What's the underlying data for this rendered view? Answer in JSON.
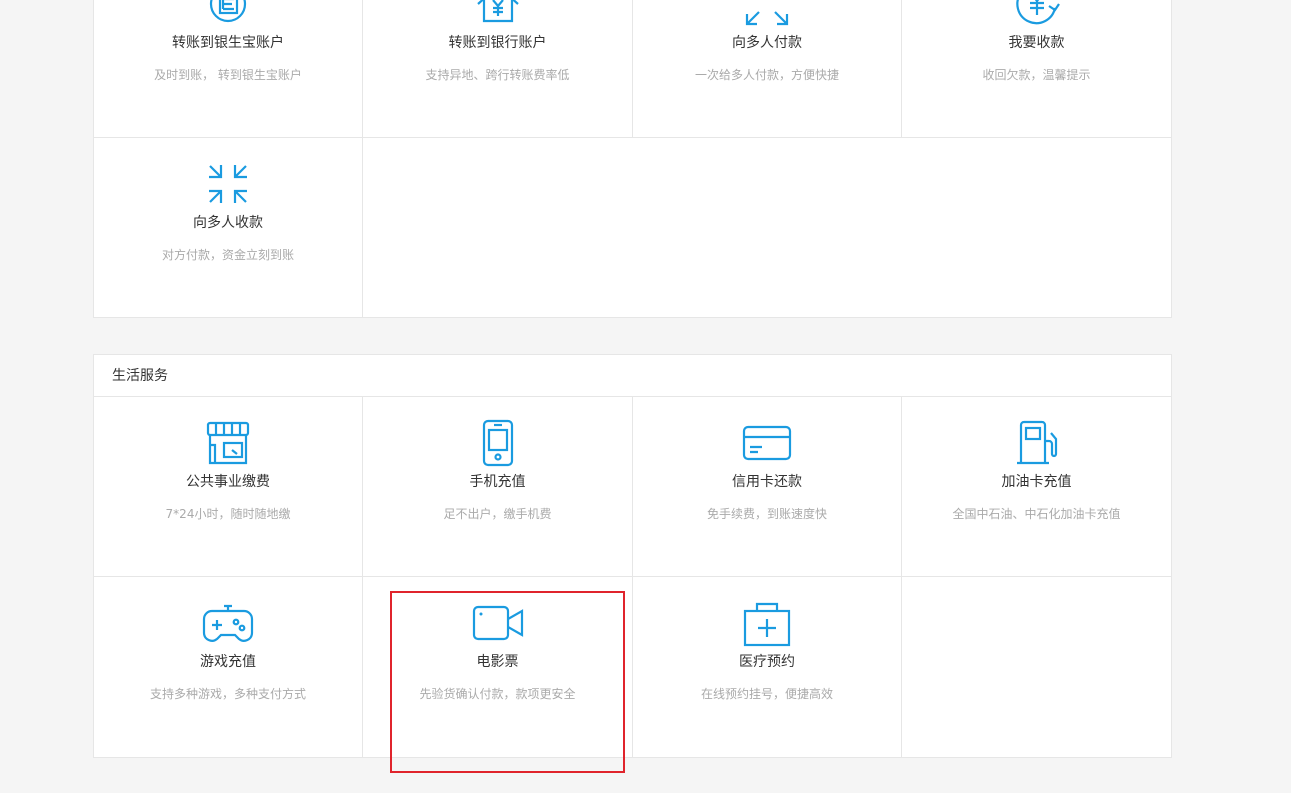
{
  "colors": {
    "accent": "#1a9be0",
    "highlight": "#e0242c"
  },
  "transfer": {
    "items": [
      {
        "title": "转账到银生宝账户",
        "desc": "及时到账， 转到银生宝账户",
        "icon": "transfer-account-icon"
      },
      {
        "title": "转账到银行账户",
        "desc": "支持异地、跨行转账费率低",
        "icon": "bank-house-yuan-icon"
      },
      {
        "title": "向多人付款",
        "desc": "一次给多人付款，方便快捷",
        "icon": "expand-arrows-icon"
      },
      {
        "title": "我要收款",
        "desc": "收回欠款，温馨提示",
        "icon": "yuan-refresh-icon"
      },
      {
        "title": "向多人收款",
        "desc": "对方付款，资金立刻到账",
        "icon": "collapse-arrows-icon"
      }
    ]
  },
  "life": {
    "header": "生活服务",
    "items": [
      {
        "title": "公共事业缴费",
        "desc": "7*24小时，随时随地缴",
        "icon": "store-icon"
      },
      {
        "title": "手机充值",
        "desc": "足不出户，缴手机费",
        "icon": "mobile-phone-icon"
      },
      {
        "title": "信用卡还款",
        "desc": "免手续费，到账速度快",
        "icon": "credit-card-icon"
      },
      {
        "title": "加油卡充值",
        "desc": "全国中石油、中石化加油卡充值",
        "icon": "fuel-pump-icon"
      },
      {
        "title": "游戏充值",
        "desc": "支持多种游戏，多种支付方式",
        "icon": "gamepad-icon"
      },
      {
        "title": "电影票",
        "desc": "先验货确认付款，款项更安全",
        "icon": "video-camera-icon"
      },
      {
        "title": "医疗预约",
        "desc": "在线预约挂号，便捷高效",
        "icon": "medical-kit-icon"
      }
    ]
  }
}
